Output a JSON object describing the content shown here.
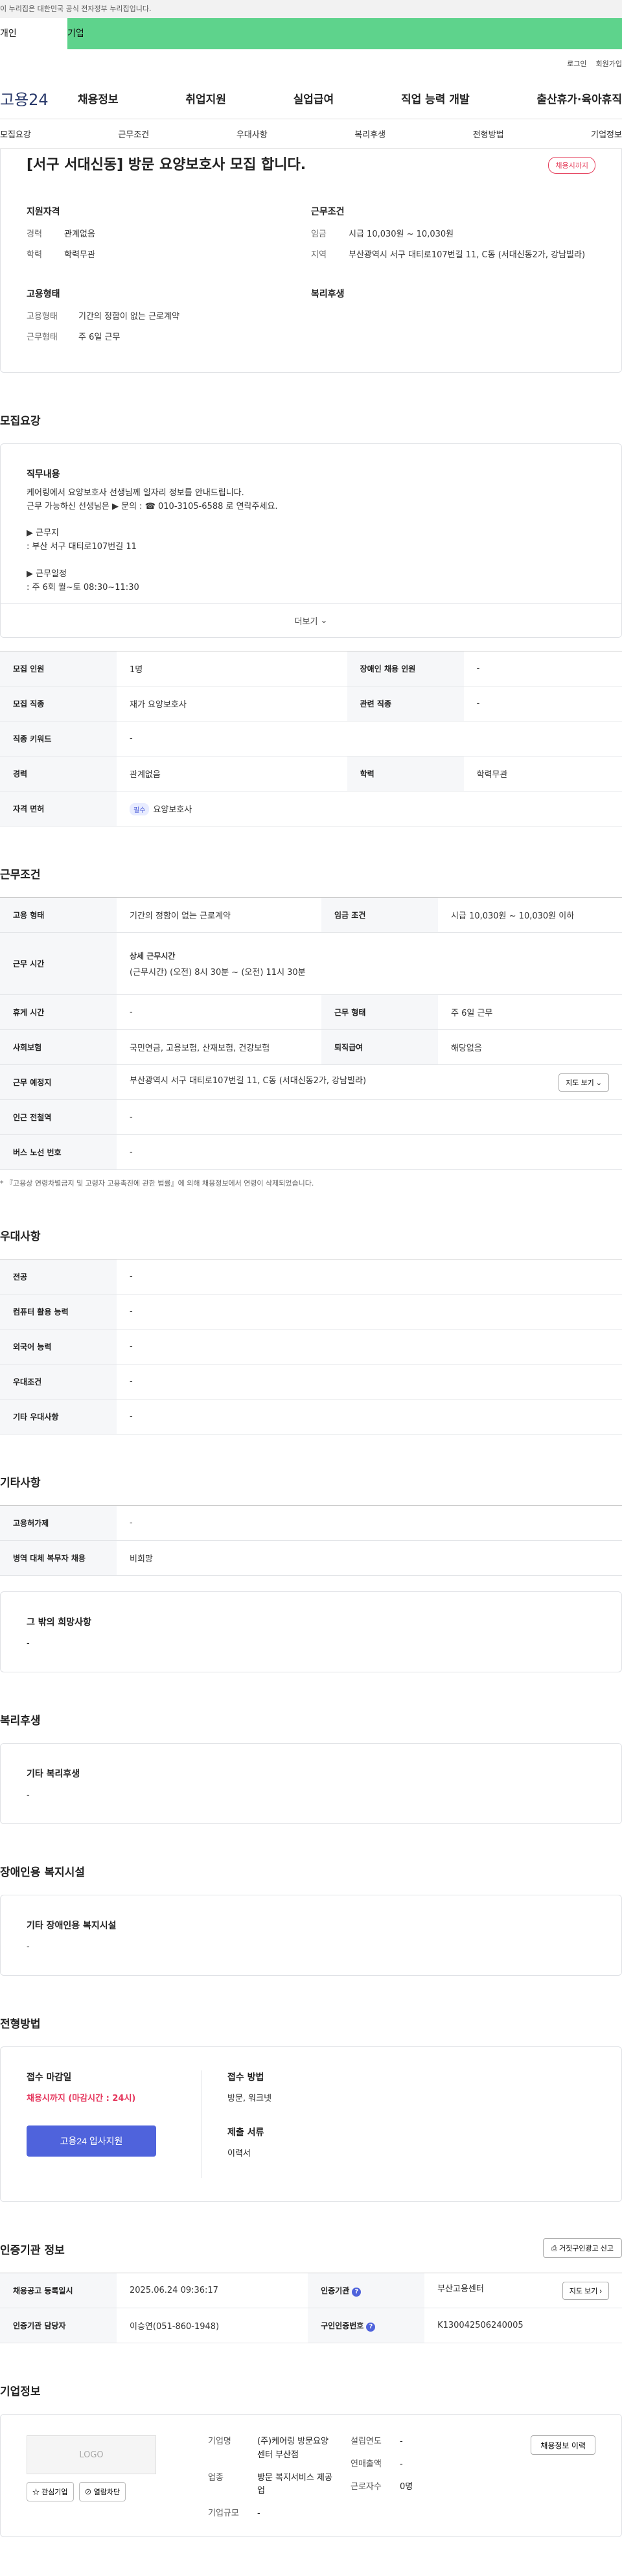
{
  "top_notice": "이 누리집은 대한민국 공식 전자정부 누리집입니다.",
  "tabs": [
    "개인",
    "기업"
  ],
  "util": [
    "로그인",
    "회원가입"
  ],
  "logo": "고용24",
  "gnb": [
    "채용정보",
    "취업지원",
    "실업급여",
    "직업 능력 개발",
    "출산휴가·육아휴직"
  ],
  "subnav": [
    "모집요강",
    "근무조건",
    "우대사항",
    "복리후생",
    "전형방법",
    "기업정보"
  ],
  "header": {
    "title": "[서구 서대신동] 방문 요양보호사 모집 합니다.",
    "badge": "채용시까지",
    "qual_title": "지원자격",
    "qual": [
      {
        "k": "경력",
        "v": "관계없음"
      },
      {
        "k": "학력",
        "v": "학력무관"
      }
    ],
    "cond_title": "근무조건",
    "cond": [
      {
        "k": "임금",
        "v": "시급 10,030원 ~ 10,030원"
      },
      {
        "k": "지역",
        "v": "부산광역시 서구 대티로107번길 11, C동 (서대신동2가, 강남빌라)"
      }
    ],
    "emp_title": "고용형태",
    "emp": [
      {
        "k": "고용형태",
        "v": "기간의 정함이 없는 근로계약"
      },
      {
        "k": "근무형태",
        "v": "주 6일 근무"
      }
    ],
    "welfare_title": "복리후생"
  },
  "recruit": {
    "title": "모집요강",
    "job_title": "직무내용",
    "job_text": "케어링에서 요양보호사 선생님께 일자리 정보를 안내드립니다.\n근무 가능하신 선생님은 ▶ 문의 : ☎ 010-3105-6588 로 연락주세요.\n\n▶ 근무지\n: 부산 서구 대티로107번길 11\n\n▶ 근무일정\n: 주 6회 월~토 08:30~11:30",
    "more": "더보기",
    "rows": {
      "headcount_k": "모집 인원",
      "headcount_v": "1명",
      "disabled_k": "장애인 채용 인원",
      "disabled_v": "-",
      "job_k": "모집 직종",
      "job_v": "재가 요양보호사",
      "related_k": "관련 직종",
      "related_v": "-",
      "keyword_k": "직종 키워드",
      "keyword_v": "-",
      "career_k": "경력",
      "career_v": "관계없음",
      "edu_k": "학력",
      "edu_v": "학력무관",
      "license_k": "자격 면허",
      "license_chip": "필수",
      "license_v": "요양보호사"
    }
  },
  "conditions": {
    "title": "근무조건",
    "emp_k": "고용 형태",
    "emp_v": "기간의 정함이 없는 근로계약",
    "wage_k": "임금 조건",
    "wage_v": "시급 10,030원 ~ 10,030원 이하",
    "time_k": "근무 시간",
    "time_sub": "상세 근무시간",
    "time_v": "(근무시간) (오전) 8시 30분 ~ (오전) 11시 30분",
    "rest_k": "휴게 시간",
    "rest_v": "-",
    "worktype_k": "근무 형태",
    "worktype_v": "주 6일 근무",
    "ins_k": "사회보험",
    "ins_v": "국민연금, 고용보험, 산재보험, 건강보험",
    "sev_k": "퇴직급여",
    "sev_v": "해당없음",
    "place_k": "근무 예정지",
    "place_v": "부산광역시 서구 대티로107번길 11, C동 (서대신동2가, 강남빌라)",
    "map_btn": "지도 보기",
    "subway_k": "인근 전철역",
    "subway_v": "-",
    "bus_k": "버스 노선 번호",
    "bus_v": "-",
    "note": "* 『고용상 연령차별금지 및 고령자 고용촉진에 관한 법률』에 의해 채용정보에서 연령이 삭제되었습니다."
  },
  "pref": {
    "title": "우대사항",
    "rows": [
      {
        "k": "전공",
        "v": "-"
      },
      {
        "k": "컴퓨터 활용 능력",
        "v": "-"
      },
      {
        "k": "외국어 능력",
        "v": "-"
      },
      {
        "k": "우대조건",
        "v": "-"
      },
      {
        "k": "기타 우대사항",
        "v": "-"
      }
    ]
  },
  "etc": {
    "title": "기타사항",
    "rows": [
      {
        "k": "고용허가제",
        "v": "-"
      },
      {
        "k": "병역 대체 복무자 채용",
        "v": "비희망"
      }
    ],
    "other_title": "그 밖의 희망사항",
    "other_v": "-"
  },
  "welfare": {
    "title": "복리후생",
    "sub": "기타 복리후생",
    "v": "-"
  },
  "disabled": {
    "title": "장애인용 복지시설",
    "sub": "기타 장애인용 복지시설",
    "v": "-"
  },
  "process": {
    "title": "전형방법",
    "deadline_title": "접수 마감일",
    "deadline_v": "채용시까지 (마감시간 : 24시)",
    "apply_btn": "고용24 입사지원",
    "method_title": "접수 방법",
    "method_v": "방문, 워크넷",
    "docs_title": "제출 서류",
    "docs_v": "이력서"
  },
  "cert": {
    "title": "인증기관 정보",
    "report_btn": "거짓구인광고 신고",
    "reg_k": "채용공고 등록일시",
    "reg_v": "2025.06.24 09:36:17",
    "org_k": "인증기관",
    "org_v": "부산고용센터",
    "map_btn": "지도 보기",
    "mgr_k": "인증기관 담당자",
    "mgr_v": "이승연(051-860-1948)",
    "no_k": "구인인증번호",
    "no_v": "K130042506240005"
  },
  "company": {
    "title": "기업정보",
    "logo": "LOGO",
    "fav_btn": "관심기업",
    "block_btn": "열람차단",
    "name_k": "기업명",
    "name_v": "(주)케어링 방문요양센터 부산점",
    "biz_k": "업종",
    "biz_v": "방문 복지서비스 제공업",
    "size_k": "기업규모",
    "size_v": "-",
    "est_k": "설립연도",
    "est_v": "-",
    "sales_k": "연매출액",
    "sales_v": "-",
    "emp_k": "근로자수",
    "emp_v": "0명",
    "history_btn": "채용정보 이력"
  }
}
